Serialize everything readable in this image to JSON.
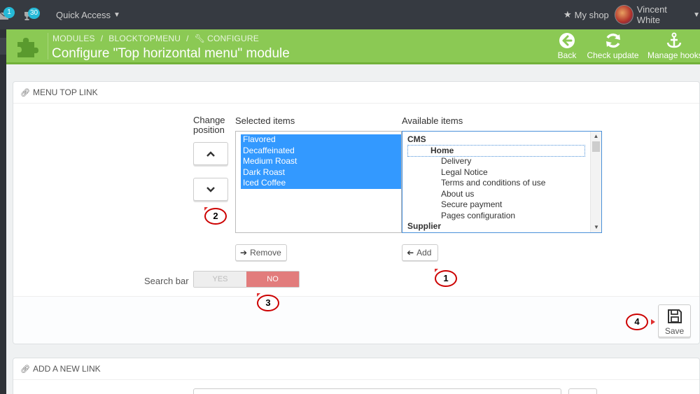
{
  "topbar": {
    "mail_count": "1",
    "trophy_count": "30",
    "quick_access": "Quick Access",
    "shop_link": "My shop",
    "user_name": "Vincent White"
  },
  "header": {
    "breadcrumb": [
      "MODULES",
      "BLOCKTOPMENU",
      "CONFIGURE"
    ],
    "title": "Configure \"Top horizontal menu\" module",
    "toolbar": [
      {
        "label": "Back",
        "icon": "circle-arrow-left-icon"
      },
      {
        "label": "Check update",
        "icon": "refresh-icon"
      },
      {
        "label": "Manage hooks",
        "icon": "anchor-icon"
      }
    ]
  },
  "menu_panel": {
    "heading": "MENU TOP LINK",
    "change_position_line1": "Change",
    "change_position_line2": "position",
    "selected_label": "Selected items",
    "available_label": "Available items",
    "selected_items": [
      "Flavored",
      "Decaffeinated",
      "Medium Roast",
      "Dark Roast",
      "Iced Coffee"
    ],
    "available_items": [
      {
        "text": "CMS",
        "level": "group"
      },
      {
        "text": "Home",
        "level": "sub"
      },
      {
        "text": "Delivery",
        "level": "leaf"
      },
      {
        "text": "Legal Notice",
        "level": "leaf"
      },
      {
        "text": "Terms and conditions of use",
        "level": "leaf"
      },
      {
        "text": "About us",
        "level": "leaf"
      },
      {
        "text": "Secure payment",
        "level": "leaf"
      },
      {
        "text": "Pages configuration",
        "level": "leaf"
      },
      {
        "text": "Supplier",
        "level": "group"
      }
    ],
    "remove_label": "Remove",
    "add_label": "Add",
    "search_bar_label": "Search bar",
    "switch_yes": "YES",
    "switch_no": "NO",
    "save_label": "Save"
  },
  "callouts": [
    "1",
    "2",
    "3",
    "4"
  ],
  "add_link_panel": {
    "heading": "ADD A NEW LINK"
  },
  "colors": {
    "header_green": "#8bc954",
    "topbar": "#363a41",
    "selection_blue": "#3399ff",
    "switch_no": "#e27c7c",
    "callout_red": "#cc0000"
  }
}
